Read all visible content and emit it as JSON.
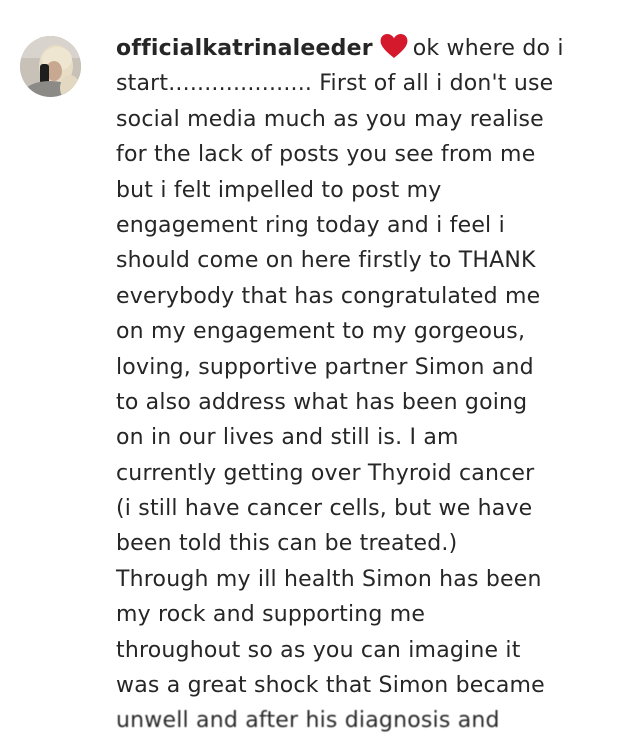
{
  "comment": {
    "username": "officialkatrinaleeder",
    "heart_icon": "red-heart-icon",
    "heart_color": "#d4192c",
    "first_line_text": "ok where do i",
    "lines": [
      "start.................... First of all i don't use",
      "social media much as you may realise",
      "for the lack of posts you see from me",
      "but i felt impelled to post my",
      "engagement ring today and i feel i",
      "should come on here firstly to THANK",
      "everybody that has congratulated me",
      "on my engagement to my gorgeous,",
      "loving, supportive partner Simon and",
      "to also address what has been going",
      "on in our lives and still is. I am",
      "currently getting over Thyroid cancer",
      "(i still have cancer cells, but we have",
      "been told this can be treated.)",
      "Through my ill health Simon has been",
      "my rock and supporting me",
      "throughout so as you can imagine it",
      "was a great shock that Simon became",
      "unwell and after his diagnosis and"
    ]
  }
}
